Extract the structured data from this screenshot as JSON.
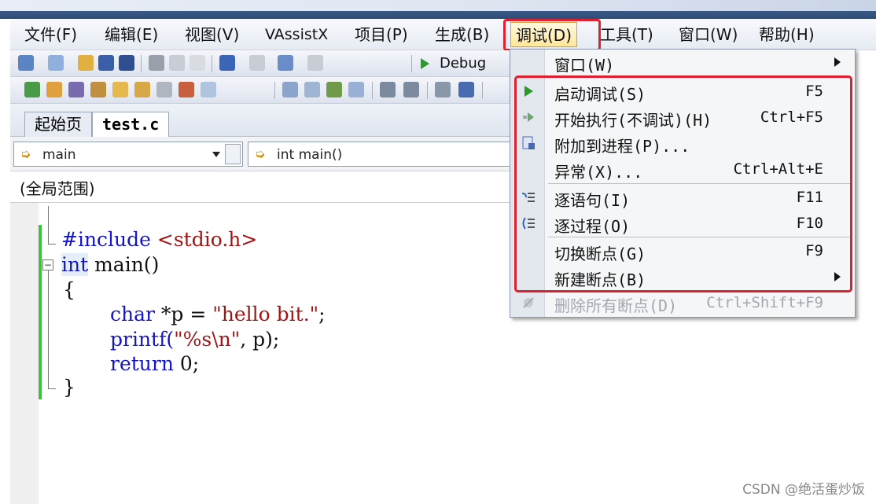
{
  "menubar": {
    "items": [
      {
        "label": "文件(F)"
      },
      {
        "label": "编辑(E)"
      },
      {
        "label": "视图(V)"
      },
      {
        "label": "VAssistX"
      },
      {
        "label": "项目(P)"
      },
      {
        "label": "生成(B)"
      },
      {
        "label": "调试(D)"
      },
      {
        "label": "工具(T)"
      },
      {
        "label": "窗口(W)"
      },
      {
        "label": "帮助(H)"
      }
    ]
  },
  "toolbar": {
    "config": "Debug"
  },
  "tabs": [
    {
      "label": "起始页"
    },
    {
      "label": "test.c"
    }
  ],
  "nav": {
    "scope_combo": "main",
    "function_combo": "int main()"
  },
  "scope_label": "(全局范围)",
  "code": {
    "line1_directive": "#include",
    "line1_header": "<stdio.h>",
    "line2_kw": "int",
    "line2_rest": " main()",
    "line3": "{",
    "line4_kw": "char",
    "line4_mid": " *p = ",
    "line4_str": "\"hello bit.\"",
    "line4_end": ";",
    "line5_fn": "printf(",
    "line5_str": "\"%s\\n\"",
    "line5_end": ", p);",
    "line6_kw": "return",
    "line6_rest": " 0;",
    "line7": "}"
  },
  "debug_menu": {
    "items": [
      {
        "label": "窗口(W)",
        "shortcut": ""
      },
      {
        "label": "启动调试(S)",
        "shortcut": "F5"
      },
      {
        "label": "开始执行(不调试)(H)",
        "shortcut": "Ctrl+F5"
      },
      {
        "label": "附加到进程(P)...",
        "shortcut": ""
      },
      {
        "label": "异常(X)...",
        "shortcut": "Ctrl+Alt+E"
      },
      {
        "label": "逐语句(I)",
        "shortcut": "F11"
      },
      {
        "label": "逐过程(O)",
        "shortcut": "F10"
      },
      {
        "label": "切换断点(G)",
        "shortcut": "F9"
      },
      {
        "label": "新建断点(B)",
        "shortcut": ""
      },
      {
        "label": "删除所有断点(D)",
        "shortcut": "Ctrl+Shift+F9"
      }
    ]
  },
  "watermark": "CSDN @绝活蛋炒饭",
  "colors": {
    "highlight": "#e0202e",
    "keyword": "#1414c8",
    "string": "#a31515",
    "change_bar": "#40c040"
  }
}
